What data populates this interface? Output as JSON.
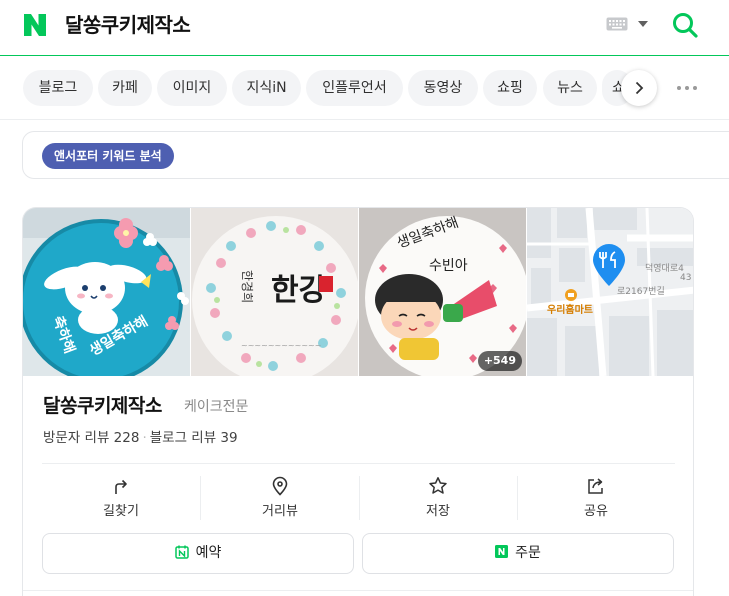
{
  "header": {
    "query": "달쏭쿠키제작소",
    "brand_color": "#03c75a"
  },
  "tabs": [
    {
      "label": "블로그"
    },
    {
      "label": "카페"
    },
    {
      "label": "이미지"
    },
    {
      "label": "지식iN"
    },
    {
      "label": "인플루언서"
    },
    {
      "label": "동영상"
    },
    {
      "label": "쇼핑"
    },
    {
      "label": "뉴스"
    },
    {
      "label": "쇼"
    }
  ],
  "keyword_badge": "앤서포터 키워드 분석",
  "place": {
    "name": "달쏭쿠키제작소",
    "category": "케이크전문",
    "visitor_reviews": "방문자 리뷰 228",
    "blog_reviews": "블로그 리뷰 39",
    "photo_more_count": "+549",
    "cake_texts": {
      "photo1": "생일축하해",
      "photo2_title": "한강",
      "photo2_sub": "한경희",
      "photo3_top": "생일축하해",
      "photo3_name": "수빈아"
    },
    "map_labels": {
      "road1": "덕영대로4",
      "road2": "로2167번길",
      "road3": "43",
      "poi": "우리홈마트"
    }
  },
  "actions": [
    {
      "label": "길찾기",
      "icon": "directions-icon"
    },
    {
      "label": "거리뷰",
      "icon": "location-pin-icon"
    },
    {
      "label": "저장",
      "icon": "star-icon"
    },
    {
      "label": "공유",
      "icon": "share-icon"
    }
  ],
  "buttons": {
    "reserve": "예약",
    "order": "주문"
  },
  "colors": {
    "accent_green": "#03c75a",
    "badge_blue": "#4e5fb1",
    "map_pin_blue": "#1e8ef0"
  }
}
